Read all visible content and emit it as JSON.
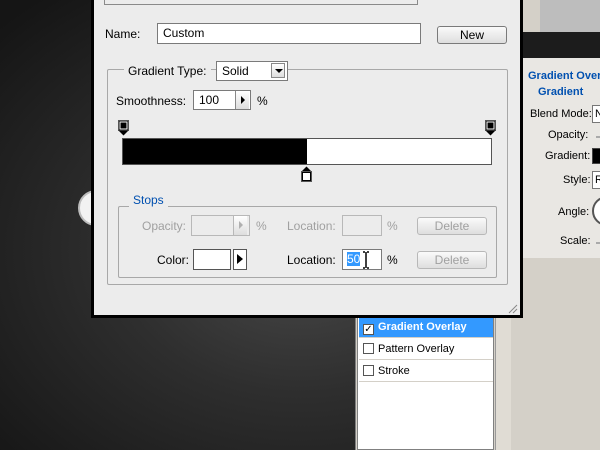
{
  "gradient_editor": {
    "name_label": "Name:",
    "name_value": "Custom",
    "new_button": "New",
    "gradient_type_label": "Gradient Type:",
    "gradient_type_value": "Solid",
    "smoothness_label": "Smoothness:",
    "smoothness_value": "100",
    "smoothness_unit": "%",
    "stops_title": "Stops",
    "opacity_label": "Opacity:",
    "opacity_value": "",
    "opacity_unit": "%",
    "opacity_location_label": "Location:",
    "opacity_location_value": "",
    "opacity_location_unit": "%",
    "opacity_delete": "Delete",
    "color_label": "Color:",
    "color_value": "#ffffff",
    "color_location_label": "Location:",
    "color_location_value": "50",
    "color_location_unit": "%",
    "color_delete": "Delete",
    "gradient_colors": [
      "#000000",
      "#ffffff"
    ],
    "gradient_split_percent": 50
  },
  "layer_style": {
    "styles_list": [
      {
        "label": "Gradient Overlay",
        "checked": true,
        "selected": true
      },
      {
        "label": "Pattern Overlay",
        "checked": false,
        "selected": false
      },
      {
        "label": "Stroke",
        "checked": false,
        "selected": false
      }
    ],
    "panel_title": "Gradient Overl",
    "section_title": "Gradient",
    "blend_mode_label": "Blend Mode:",
    "blend_mode_value": "N",
    "opacity_label": "Opacity:",
    "gradient_label": "Gradient:",
    "style_label": "Style:",
    "style_value": "R",
    "angle_label": "Angle:",
    "scale_label": "Scale:"
  },
  "colors": {
    "selection_blue": "#3399ff",
    "section_title_blue": "#0050b0",
    "dialog_bg": "#ececec"
  }
}
